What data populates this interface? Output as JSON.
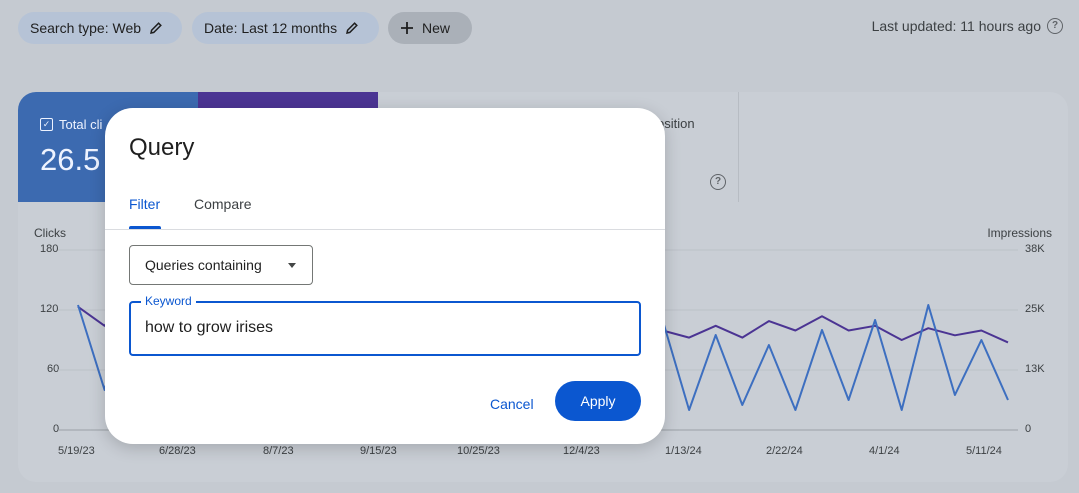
{
  "filters": {
    "search_type": "Search type: Web",
    "date": "Date: Last 12 months",
    "new_label": "New"
  },
  "status": {
    "last_updated": "Last updated: 11 hours ago"
  },
  "metrics": {
    "clicks_label": "Total cli",
    "clicks_value": "26.5",
    "position_label": "osition"
  },
  "chart_data": {
    "type": "line",
    "left_axis_label": "Clicks",
    "right_axis_label": "Impressions",
    "left_ticks": [
      "180",
      "120",
      "60",
      "0"
    ],
    "right_ticks": [
      "38K",
      "25K",
      "13K",
      "0"
    ],
    "left_ylim": [
      0,
      180
    ],
    "right_ylim": [
      0,
      38000
    ],
    "x_ticks": [
      "5/19/23",
      "6/28/23",
      "8/7/23",
      "9/15/23",
      "10/25/23",
      "12/4/23",
      "1/13/24",
      "2/22/24",
      "4/1/24",
      "5/11/24"
    ],
    "series": [
      {
        "axis": "right",
        "color": "#4b3493",
        "values": [
          26000,
          22000,
          29000,
          27000,
          19000,
          16000,
          17000,
          17500,
          18000,
          19000,
          20000,
          18000,
          21500,
          20000,
          21000,
          19000,
          22500,
          19000,
          22000,
          20500,
          23000,
          20000,
          21000,
          19500,
          22000,
          19500,
          23000,
          21000,
          24000,
          21000,
          22000,
          19000,
          21500,
          20000,
          21000,
          18500
        ]
      },
      {
        "axis": "left",
        "color": "#3d6fc0",
        "values": [
          125,
          40,
          140,
          120,
          35,
          30,
          90,
          45,
          80,
          30,
          95,
          25,
          100,
          30,
          85,
          20,
          105,
          35,
          100,
          20,
          90,
          30,
          110,
          20,
          95,
          25,
          85,
          20,
          100,
          30,
          110,
          20,
          125,
          35,
          90,
          30
        ]
      }
    ]
  },
  "dialog": {
    "title": "Query",
    "tab_filter": "Filter",
    "tab_compare": "Compare",
    "select_value": "Queries containing",
    "keyword_label": "Keyword",
    "keyword_value": "how to grow irises",
    "cancel_label": "Cancel",
    "apply_label": "Apply"
  },
  "colors": {
    "primary": "#0b57d0",
    "clicks_card": "#3c6ab0",
    "impressions_card": "#4b3493"
  }
}
